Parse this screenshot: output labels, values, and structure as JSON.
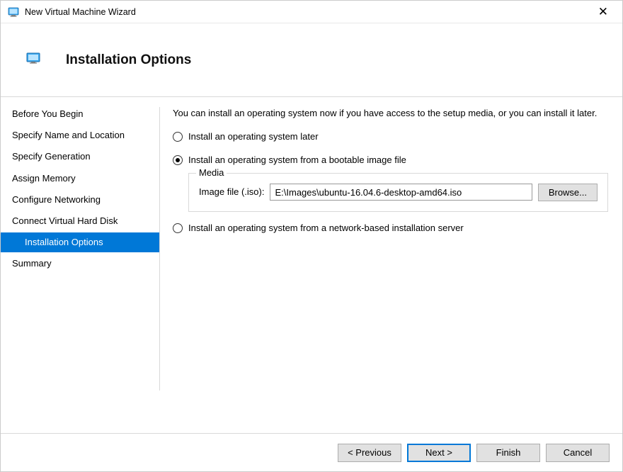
{
  "window": {
    "title": "New Virtual Machine Wizard"
  },
  "header": {
    "title": "Installation Options"
  },
  "sidebar": {
    "items": [
      {
        "label": "Before You Begin"
      },
      {
        "label": "Specify Name and Location"
      },
      {
        "label": "Specify Generation"
      },
      {
        "label": "Assign Memory"
      },
      {
        "label": "Configure Networking"
      },
      {
        "label": "Connect Virtual Hard Disk"
      },
      {
        "label": "Installation Options"
      },
      {
        "label": "Summary"
      }
    ]
  },
  "main": {
    "intro": "You can install an operating system now if you have access to the setup media, or you can install it later.",
    "radio_later": "Install an operating system later",
    "radio_image": "Install an operating system from a bootable image file",
    "radio_network": "Install an operating system from a network-based installation server",
    "media_legend": "Media",
    "media_label": "Image file (.iso):",
    "media_value": "E:\\Images\\ubuntu-16.04.6-desktop-amd64.iso",
    "browse": "Browse..."
  },
  "footer": {
    "previous": "< Previous",
    "next": "Next >",
    "finish": "Finish",
    "cancel": "Cancel"
  }
}
